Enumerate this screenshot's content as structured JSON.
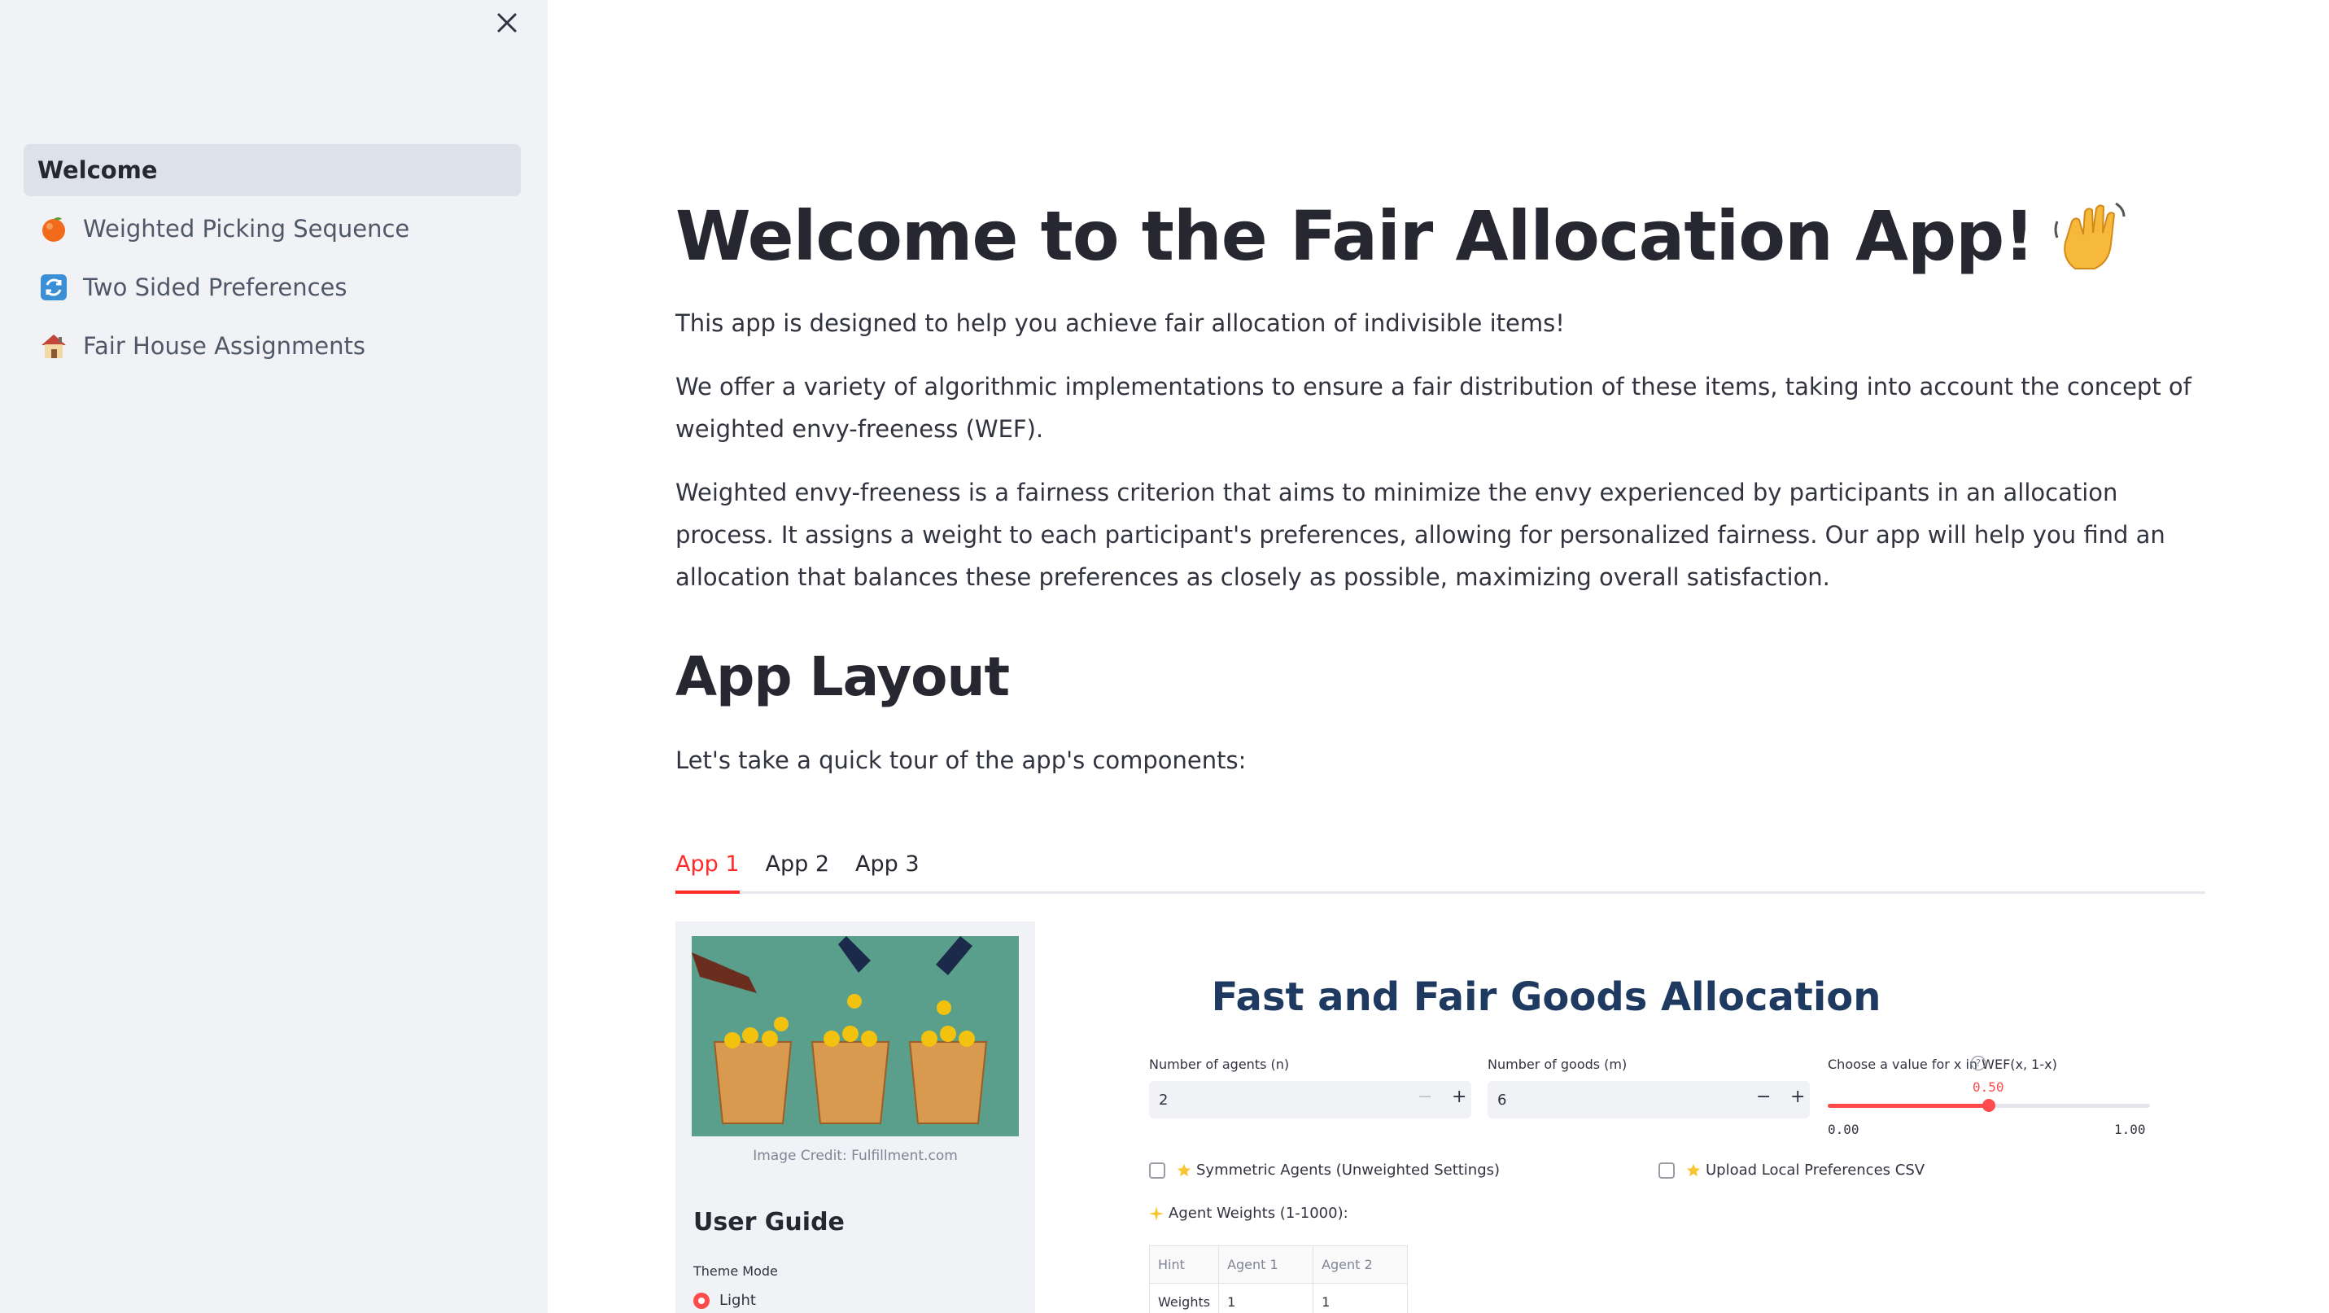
{
  "sidebar": {
    "close_label": "×",
    "items": [
      {
        "label": "Welcome",
        "icon": "none",
        "active": true
      },
      {
        "label": "Weighted Picking Sequence",
        "icon": "orange-fruit-icon"
      },
      {
        "label": "Two Sided Preferences",
        "icon": "arrows-cycle-icon"
      },
      {
        "label": "Fair House Assignments",
        "icon": "house-icon"
      }
    ]
  },
  "main": {
    "title": "Welcome to the Fair Allocation App!",
    "title_icon": "waving-hand-icon",
    "paragraphs": [
      "This app is designed to help you achieve fair allocation of indivisible items!",
      "We offer a variety of algorithmic implementations to ensure a fair distribution of these items, taking into account the concept of weighted envy-freeness (WEF).",
      "Weighted envy-freeness is a fairness criterion that aims to minimize the envy experienced by participants in an allocation process. It assigns a weight to each participant's preferences, allowing for personalized fairness. Our app will help you find an allocation that balances these preferences as closely as possible, maximizing overall satisfaction."
    ],
    "section_title": "App Layout",
    "section_intro": "Let's take a quick tour of the app's components:",
    "tabs": [
      {
        "label": "App 1",
        "active": true
      },
      {
        "label": "App 2"
      },
      {
        "label": "App 3"
      }
    ]
  },
  "preview": {
    "image_caption": "Image Credit: Fulfillment.com",
    "user_guide": "User Guide",
    "theme_label": "Theme Mode",
    "theme_option": "Light",
    "title": "Fast and Fair Goods Allocation",
    "agents_label": "Number of agents (n)",
    "agents_value": "2",
    "goods_label": "Number of goods (m)",
    "goods_value": "6",
    "x_label": "Choose a value for x in WEF(x, 1-x)",
    "x_value": "0.50",
    "x_fraction": 0.5,
    "x_min": "0.00",
    "x_max": "1.00",
    "symmetric_label": "Symmetric Agents (Unweighted Settings)",
    "upload_label": "Upload Local Preferences CSV",
    "weights_label": "Agent Weights (1-1000):",
    "table_headers": [
      "Hint",
      "Agent 1",
      "Agent 2"
    ],
    "table_row": [
      "Weights",
      "1",
      "1"
    ],
    "minus": "−",
    "plus": "+",
    "help": "?"
  },
  "colors": {
    "accent": "#ff2b2b",
    "sidebar_bg": "#f0f2f6",
    "active_item_bg": "#dde1e9",
    "preview_title": "#1f3a60"
  }
}
